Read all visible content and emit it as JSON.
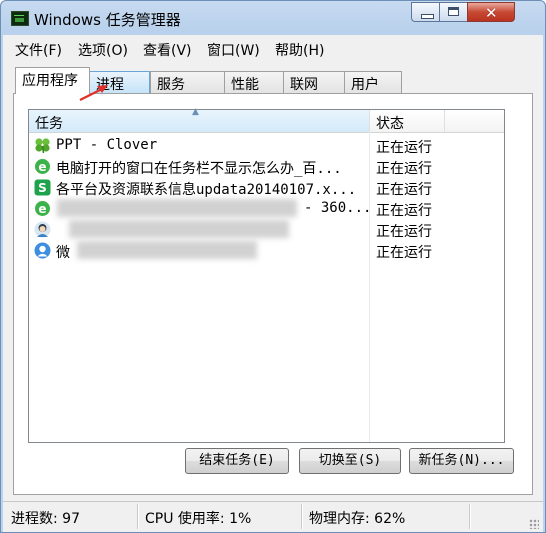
{
  "window": {
    "title": "Windows 任务管理器"
  },
  "menu": [
    "文件(F)",
    "选项(O)",
    "查看(V)",
    "窗口(W)",
    "帮助(H)"
  ],
  "tabs": [
    {
      "label": "应用程序",
      "active": true
    },
    {
      "label": "进程",
      "highlighted": true
    },
    {
      "label": "服务"
    },
    {
      "label": "性能"
    },
    {
      "label": "联网"
    },
    {
      "label": "用户"
    }
  ],
  "table": {
    "columns": [
      "任务",
      "状态"
    ],
    "rows": [
      {
        "icon": "clover-icon",
        "task": "PPT - Clover",
        "status": "正在运行"
      },
      {
        "icon": "ie-browser-icon",
        "task": "电脑打开的窗口在任务栏不显示怎么办_百...",
        "status": "正在运行"
      },
      {
        "icon": "green-s-app-icon",
        "task": "各平台及资源联系信息updata20140107.x...",
        "status": "正在运行"
      },
      {
        "icon": "ie-browser-icon",
        "task": "- 360...",
        "status": "正在运行"
      },
      {
        "icon": "qq-avatar-icon",
        "task": "",
        "status": "正在运行"
      },
      {
        "icon": "user-avatar-icon",
        "task": "微",
        "status": "正在运行"
      }
    ]
  },
  "buttons": {
    "end_task": "结束任务(E)",
    "switch_to": "切换至(S)",
    "new_task": "新任务(N)..."
  },
  "status": {
    "processes": "进程数: 97",
    "cpu": "CPU 使用率: 1%",
    "memory": "物理内存: 62%"
  },
  "colors": {
    "title_bar": "#b9d1ec",
    "close_button": "#c74a35",
    "selected_tab": "#c5e4f8",
    "arrow": "#e0302a"
  }
}
